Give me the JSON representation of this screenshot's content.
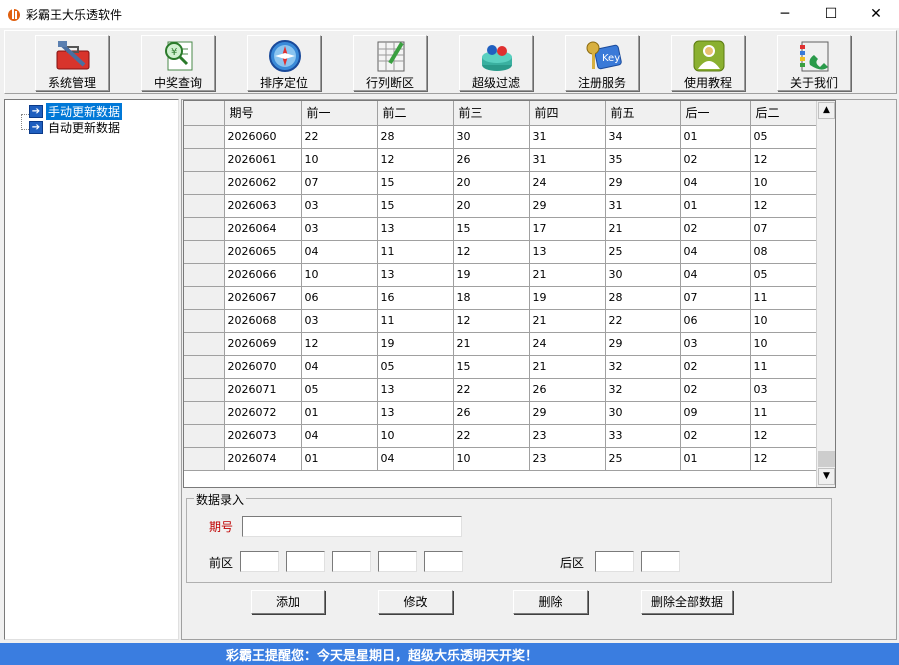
{
  "window": {
    "title": "彩霸王大乐透软件",
    "minimize": "─",
    "maximize": "☐",
    "close": "✕"
  },
  "toolbar": [
    {
      "label": "系统管理",
      "icon": "toolbox-icon"
    },
    {
      "label": "中奖查询",
      "icon": "search-document-icon"
    },
    {
      "label": "排序定位",
      "icon": "compass-icon"
    },
    {
      "label": "行列断区",
      "icon": "notepad-pencil-icon"
    },
    {
      "label": "超级过滤",
      "icon": "filter-balls-icon"
    },
    {
      "label": "注册服务",
      "icon": "keys-icon"
    },
    {
      "label": "使用教程",
      "icon": "user-guide-icon"
    },
    {
      "label": "关于我们",
      "icon": "phone-book-icon"
    }
  ],
  "tree": {
    "items": [
      {
        "label": "手动更新数据",
        "selected": true
      },
      {
        "label": "自动更新数据",
        "selected": false
      }
    ]
  },
  "grid": {
    "columns": [
      "期号",
      "前一",
      "前二",
      "前三",
      "前四",
      "前五",
      "后一",
      "后二"
    ],
    "rows": [
      [
        "2026060",
        "22",
        "28",
        "30",
        "31",
        "34",
        "01",
        "05"
      ],
      [
        "2026061",
        "10",
        "12",
        "26",
        "31",
        "35",
        "02",
        "12"
      ],
      [
        "2026062",
        "07",
        "15",
        "20",
        "24",
        "29",
        "04",
        "10"
      ],
      [
        "2026063",
        "03",
        "15",
        "20",
        "29",
        "31",
        "01",
        "12"
      ],
      [
        "2026064",
        "03",
        "13",
        "15",
        "17",
        "21",
        "02",
        "07"
      ],
      [
        "2026065",
        "04",
        "11",
        "12",
        "13",
        "25",
        "04",
        "08"
      ],
      [
        "2026066",
        "10",
        "13",
        "19",
        "21",
        "30",
        "04",
        "05"
      ],
      [
        "2026067",
        "06",
        "16",
        "18",
        "19",
        "28",
        "07",
        "11"
      ],
      [
        "2026068",
        "03",
        "11",
        "12",
        "21",
        "22",
        "06",
        "10"
      ],
      [
        "2026069",
        "12",
        "19",
        "21",
        "24",
        "29",
        "03",
        "10"
      ],
      [
        "2026070",
        "04",
        "05",
        "15",
        "21",
        "32",
        "02",
        "11"
      ],
      [
        "2026071",
        "05",
        "13",
        "22",
        "26",
        "32",
        "02",
        "03"
      ],
      [
        "2026072",
        "01",
        "13",
        "26",
        "29",
        "30",
        "09",
        "11"
      ],
      [
        "2026073",
        "04",
        "10",
        "22",
        "23",
        "33",
        "02",
        "12"
      ],
      [
        "2026074",
        "01",
        "04",
        "10",
        "23",
        "25",
        "01",
        "12"
      ]
    ]
  },
  "entry": {
    "group_title": "数据录入",
    "qihao_label": "期号",
    "qihao_value": "",
    "front_label": "前区",
    "back_label": "后区",
    "front_values": [
      "",
      "",
      "",
      "",
      ""
    ],
    "back_values": [
      "",
      ""
    ]
  },
  "actions": {
    "add": "添加",
    "modify": "修改",
    "delete": "删除",
    "delete_all": "删除全部数据"
  },
  "status": {
    "message": "彩霸王提醒您：今天是星期日，超级大乐透明天开奖！"
  },
  "colors": {
    "status_bar": "#3a7de0",
    "selection": "#0078d7",
    "label_red": "#c00000"
  }
}
